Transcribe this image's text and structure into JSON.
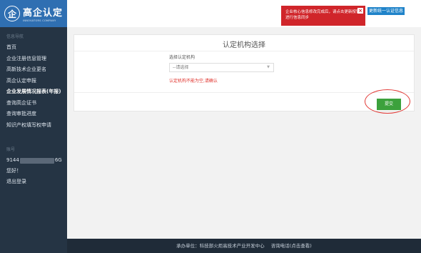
{
  "brand": {
    "title": "高企认定",
    "subtitle": "INNOVATORS COMPANY"
  },
  "sidebar": {
    "section_label": "信息导航",
    "items": [
      {
        "label": "首页"
      },
      {
        "label": "企业注册信息管理"
      },
      {
        "label": "高新技术企业更名"
      },
      {
        "label": "高企认定申报"
      },
      {
        "label": "企业发展情况报表(年报)"
      },
      {
        "label": "查询高企证书"
      },
      {
        "label": "查询审批进度"
      },
      {
        "label": "知识产权填写权申请"
      }
    ],
    "active_index": 4
  },
  "account": {
    "section_label": "账号",
    "id_prefix": "9144",
    "id_suffix": "6G",
    "greeting": "您好！",
    "logout_label": "退出登录"
  },
  "topbar": {
    "alert_text": "企业核心信息修改完成后，请点击更新按钮进行信息同步",
    "alert_close": "×",
    "update_button": "更新统一认证信息"
  },
  "main": {
    "title": "认定机构选择",
    "field_label": "选择认定机构",
    "select_value": "--请选择",
    "error_text": "认定机构不能为空,请确认",
    "submit_label": "提交"
  },
  "footer": {
    "org": "承办单位：科技部火炬高技术产业开发中心",
    "contact": "咨询电话(点击查看)"
  },
  "colors": {
    "sidebar_bg": "#253444",
    "brand_blue": "#2f6fb2",
    "alert_red": "#d0252a",
    "submit_green": "#3ca13c"
  }
}
